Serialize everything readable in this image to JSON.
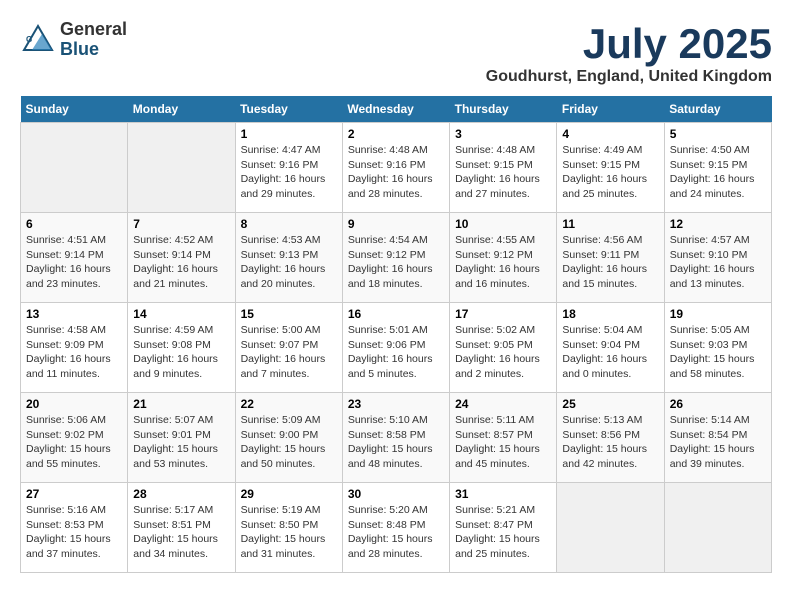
{
  "header": {
    "logo_general": "General",
    "logo_blue": "Blue",
    "month_year": "July 2025",
    "location": "Goudhurst, England, United Kingdom"
  },
  "days_of_week": [
    "Sunday",
    "Monday",
    "Tuesday",
    "Wednesday",
    "Thursday",
    "Friday",
    "Saturday"
  ],
  "weeks": [
    [
      {
        "day": "",
        "info": ""
      },
      {
        "day": "",
        "info": ""
      },
      {
        "day": "1",
        "info": "Sunrise: 4:47 AM\nSunset: 9:16 PM\nDaylight: 16 hours and 29 minutes."
      },
      {
        "day": "2",
        "info": "Sunrise: 4:48 AM\nSunset: 9:16 PM\nDaylight: 16 hours and 28 minutes."
      },
      {
        "day": "3",
        "info": "Sunrise: 4:48 AM\nSunset: 9:15 PM\nDaylight: 16 hours and 27 minutes."
      },
      {
        "day": "4",
        "info": "Sunrise: 4:49 AM\nSunset: 9:15 PM\nDaylight: 16 hours and 25 minutes."
      },
      {
        "day": "5",
        "info": "Sunrise: 4:50 AM\nSunset: 9:15 PM\nDaylight: 16 hours and 24 minutes."
      }
    ],
    [
      {
        "day": "6",
        "info": "Sunrise: 4:51 AM\nSunset: 9:14 PM\nDaylight: 16 hours and 23 minutes."
      },
      {
        "day": "7",
        "info": "Sunrise: 4:52 AM\nSunset: 9:14 PM\nDaylight: 16 hours and 21 minutes."
      },
      {
        "day": "8",
        "info": "Sunrise: 4:53 AM\nSunset: 9:13 PM\nDaylight: 16 hours and 20 minutes."
      },
      {
        "day": "9",
        "info": "Sunrise: 4:54 AM\nSunset: 9:12 PM\nDaylight: 16 hours and 18 minutes."
      },
      {
        "day": "10",
        "info": "Sunrise: 4:55 AM\nSunset: 9:12 PM\nDaylight: 16 hours and 16 minutes."
      },
      {
        "day": "11",
        "info": "Sunrise: 4:56 AM\nSunset: 9:11 PM\nDaylight: 16 hours and 15 minutes."
      },
      {
        "day": "12",
        "info": "Sunrise: 4:57 AM\nSunset: 9:10 PM\nDaylight: 16 hours and 13 minutes."
      }
    ],
    [
      {
        "day": "13",
        "info": "Sunrise: 4:58 AM\nSunset: 9:09 PM\nDaylight: 16 hours and 11 minutes."
      },
      {
        "day": "14",
        "info": "Sunrise: 4:59 AM\nSunset: 9:08 PM\nDaylight: 16 hours and 9 minutes."
      },
      {
        "day": "15",
        "info": "Sunrise: 5:00 AM\nSunset: 9:07 PM\nDaylight: 16 hours and 7 minutes."
      },
      {
        "day": "16",
        "info": "Sunrise: 5:01 AM\nSunset: 9:06 PM\nDaylight: 16 hours and 5 minutes."
      },
      {
        "day": "17",
        "info": "Sunrise: 5:02 AM\nSunset: 9:05 PM\nDaylight: 16 hours and 2 minutes."
      },
      {
        "day": "18",
        "info": "Sunrise: 5:04 AM\nSunset: 9:04 PM\nDaylight: 16 hours and 0 minutes."
      },
      {
        "day": "19",
        "info": "Sunrise: 5:05 AM\nSunset: 9:03 PM\nDaylight: 15 hours and 58 minutes."
      }
    ],
    [
      {
        "day": "20",
        "info": "Sunrise: 5:06 AM\nSunset: 9:02 PM\nDaylight: 15 hours and 55 minutes."
      },
      {
        "day": "21",
        "info": "Sunrise: 5:07 AM\nSunset: 9:01 PM\nDaylight: 15 hours and 53 minutes."
      },
      {
        "day": "22",
        "info": "Sunrise: 5:09 AM\nSunset: 9:00 PM\nDaylight: 15 hours and 50 minutes."
      },
      {
        "day": "23",
        "info": "Sunrise: 5:10 AM\nSunset: 8:58 PM\nDaylight: 15 hours and 48 minutes."
      },
      {
        "day": "24",
        "info": "Sunrise: 5:11 AM\nSunset: 8:57 PM\nDaylight: 15 hours and 45 minutes."
      },
      {
        "day": "25",
        "info": "Sunrise: 5:13 AM\nSunset: 8:56 PM\nDaylight: 15 hours and 42 minutes."
      },
      {
        "day": "26",
        "info": "Sunrise: 5:14 AM\nSunset: 8:54 PM\nDaylight: 15 hours and 39 minutes."
      }
    ],
    [
      {
        "day": "27",
        "info": "Sunrise: 5:16 AM\nSunset: 8:53 PM\nDaylight: 15 hours and 37 minutes."
      },
      {
        "day": "28",
        "info": "Sunrise: 5:17 AM\nSunset: 8:51 PM\nDaylight: 15 hours and 34 minutes."
      },
      {
        "day": "29",
        "info": "Sunrise: 5:19 AM\nSunset: 8:50 PM\nDaylight: 15 hours and 31 minutes."
      },
      {
        "day": "30",
        "info": "Sunrise: 5:20 AM\nSunset: 8:48 PM\nDaylight: 15 hours and 28 minutes."
      },
      {
        "day": "31",
        "info": "Sunrise: 5:21 AM\nSunset: 8:47 PM\nDaylight: 15 hours and 25 minutes."
      },
      {
        "day": "",
        "info": ""
      },
      {
        "day": "",
        "info": ""
      }
    ]
  ]
}
